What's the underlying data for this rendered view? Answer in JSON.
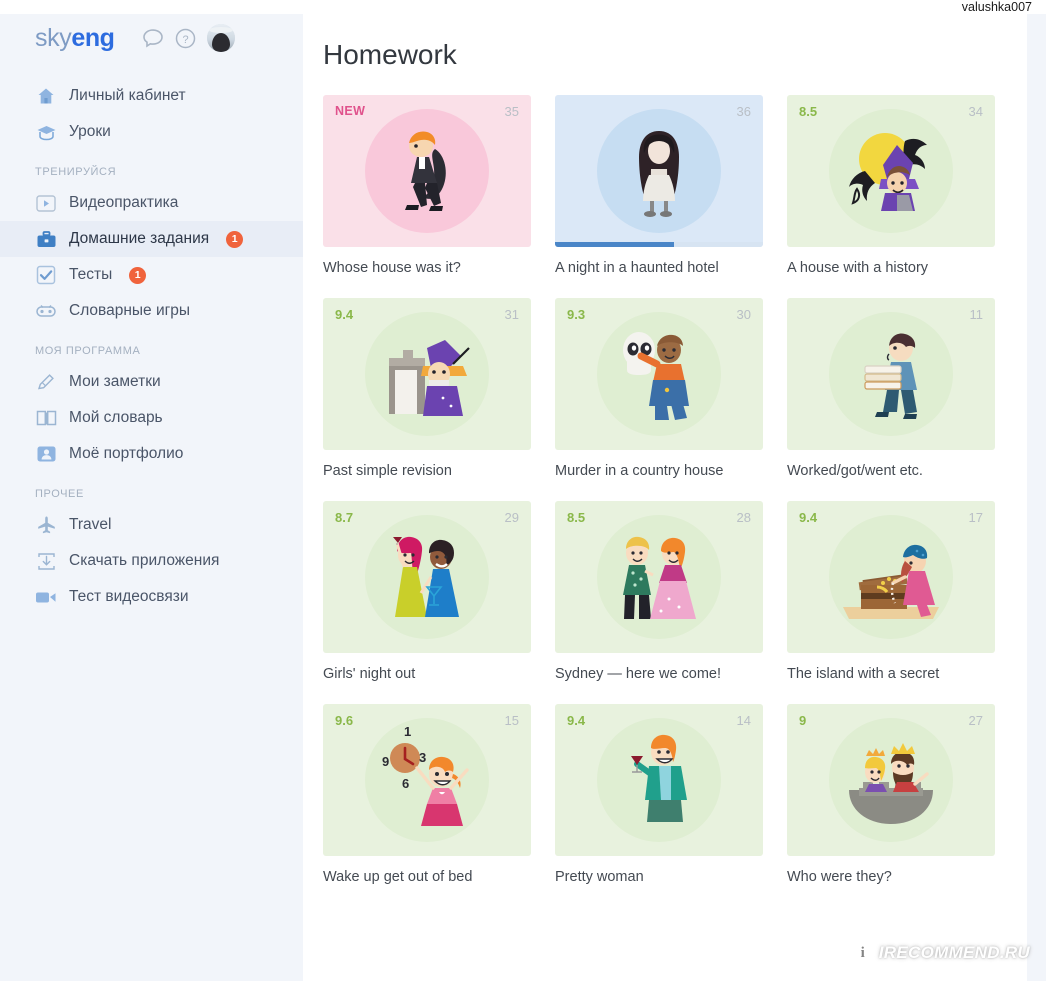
{
  "account": {
    "username": "valushka007"
  },
  "brand": {
    "logo_light": "sky",
    "logo_bold": "eng",
    "chat_icon": "chat-bubble-icon",
    "help_icon": "question-mark-icon",
    "avatar_icon": "user-avatar"
  },
  "sidebar": {
    "groups": [
      {
        "title": null,
        "items": [
          {
            "label": "Личный кабинет",
            "icon": "home-icon",
            "badge": null,
            "active": false
          },
          {
            "label": "Уроки",
            "icon": "graduation-cap-icon",
            "badge": null,
            "active": false
          }
        ]
      },
      {
        "title": "ТРЕНИРУЙСЯ",
        "items": [
          {
            "label": "Видеопрактика",
            "icon": "play-button-icon",
            "badge": null,
            "active": false
          },
          {
            "label": "Домашние задания",
            "icon": "briefcase-icon",
            "badge": "1",
            "active": true
          },
          {
            "label": "Тесты",
            "icon": "checkbox-icon",
            "badge": "1",
            "active": false
          },
          {
            "label": "Словарные игры",
            "icon": "gamepad-icon",
            "badge": null,
            "active": false
          }
        ]
      },
      {
        "title": "МОЯ ПРОГРАММА",
        "items": [
          {
            "label": "Мои заметки",
            "icon": "pencil-icon",
            "badge": null,
            "active": false
          },
          {
            "label": "Мой словарь",
            "icon": "open-book-icon",
            "badge": null,
            "active": false
          },
          {
            "label": "Моё портфолио",
            "icon": "portfolio-person-icon",
            "badge": null,
            "active": false
          }
        ]
      },
      {
        "title": "ПРОЧЕЕ",
        "items": [
          {
            "label": "Travel",
            "icon": "airplane-icon",
            "badge": null,
            "active": false
          },
          {
            "label": "Скачать приложения",
            "icon": "download-icon",
            "badge": null,
            "active": false
          },
          {
            "label": "Тест видеосвязи",
            "icon": "video-camera-icon",
            "badge": null,
            "active": false
          }
        ]
      }
    ]
  },
  "main": {
    "title": "Homework",
    "cards": [
      {
        "title": "Whose house was it?",
        "score": "NEW",
        "score_type": "new",
        "count": "35",
        "bg": "#fae0e8",
        "circle": "#f9c8da",
        "illustration": "boy-in-cape-running",
        "progress": null
      },
      {
        "title": "A night in a haunted hotel",
        "score": null,
        "score_type": "none",
        "count": "36",
        "bg": "#dbe8f7",
        "circle": "#c6ddf2",
        "illustration": "girl-with-long-black-hair",
        "progress": 57
      },
      {
        "title": "A house with a history",
        "score": "8.5",
        "score_type": "green",
        "count": "34",
        "bg": "#e8f2de",
        "circle": "#dfeed2",
        "illustration": "witch-with-bats-and-moon",
        "progress": null
      },
      {
        "title": "Past simple revision",
        "score": "9.4",
        "score_type": "green",
        "count": "31",
        "bg": "#e8f2de",
        "circle": "#dfeed2",
        "illustration": "wizard-at-castle-tower",
        "progress": null
      },
      {
        "title": "Murder in a country house",
        "score": "9.3",
        "score_type": "green",
        "count": "30",
        "bg": "#e8f2de",
        "circle": "#dfeed2",
        "illustration": "person-holding-skull",
        "progress": null
      },
      {
        "title": "Worked/got/went etc.",
        "score": null,
        "score_type": "none",
        "count": "11",
        "bg": "#e8f2de",
        "circle": "#dfeed2",
        "illustration": "boy-carrying-books",
        "progress": null
      },
      {
        "title": "Girls' night out",
        "score": "8.7",
        "score_type": "green",
        "count": "29",
        "bg": "#e8f2de",
        "circle": "#dfeed2",
        "illustration": "two-girls-with-cocktails",
        "progress": null
      },
      {
        "title": "Sydney — here we come!",
        "score": "8.5",
        "score_type": "green",
        "count": "28",
        "bg": "#e8f2de",
        "circle": "#dfeed2",
        "illustration": "couple-and-woman-in-pink-dress",
        "progress": null
      },
      {
        "title": "The island with a secret",
        "score": "9.4",
        "score_type": "green",
        "count": "17",
        "bg": "#e8f2de",
        "circle": "#dfeed2",
        "illustration": "pirate-girl-with-treasure-chest",
        "progress": null
      },
      {
        "title": "Wake up get out of bed",
        "score": "9.6",
        "score_type": "green",
        "count": "15",
        "bg": "#e8f2de",
        "circle": "#dfeed2",
        "illustration": "girl-with-alarm-clock",
        "progress": null
      },
      {
        "title": "Pretty woman",
        "score": "9.4",
        "score_type": "green",
        "count": "14",
        "bg": "#e8f2de",
        "circle": "#dfeed2",
        "illustration": "woman-with-wine-glass",
        "progress": null
      },
      {
        "title": "Who were they?",
        "score": "9",
        "score_type": "green",
        "count": "27",
        "bg": "#e8f2de",
        "circle": "#dfeed2",
        "illustration": "king-and-princess-on-castle",
        "progress": null
      }
    ]
  },
  "watermark": {
    "logo_letter": "i",
    "text": "IRECOMMEND.RU"
  },
  "colors": {
    "sidebar_bg": "#f2f5fa",
    "panel_bg": "#ffffff",
    "accent_blue": "#2d6cdf",
    "badge_red": "#f0633c",
    "score_green": "#8ab84a",
    "new_pink": "#e0528c",
    "progress_blue": "#4a86c8"
  }
}
